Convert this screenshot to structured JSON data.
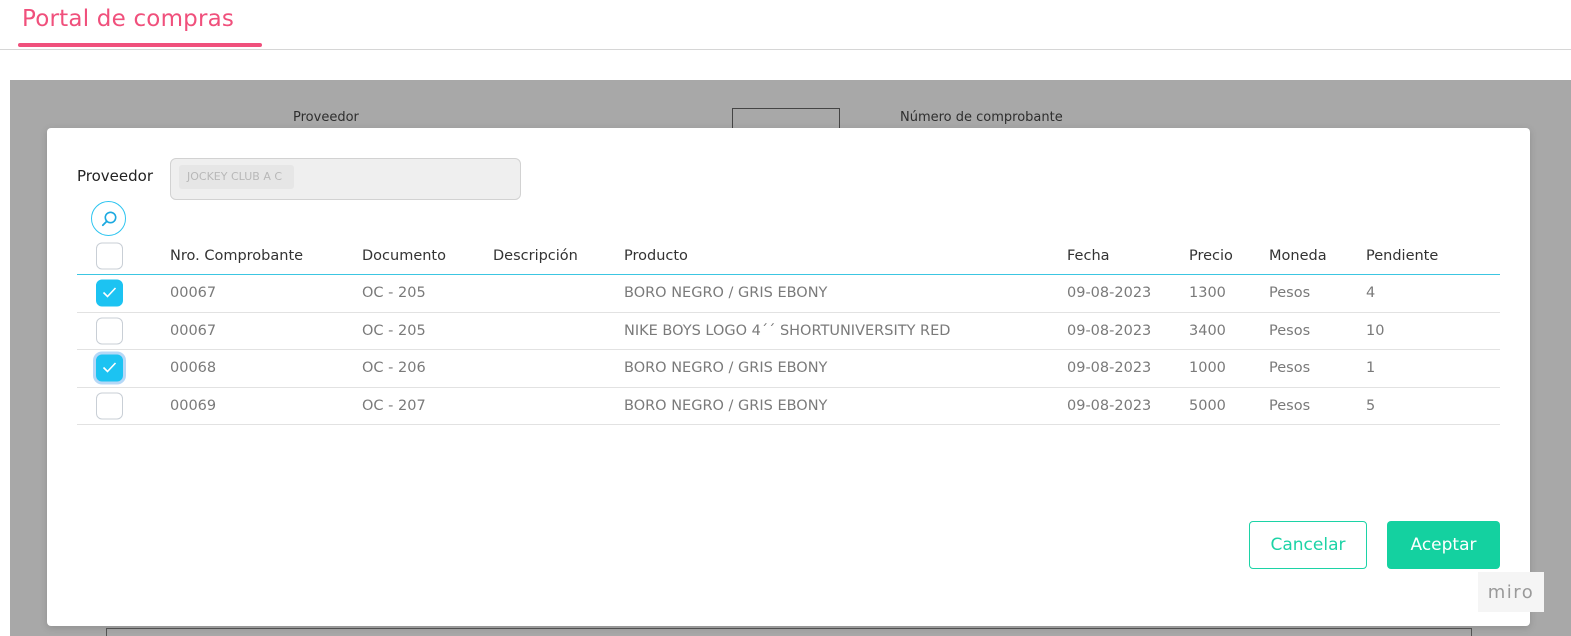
{
  "header": {
    "title": "Portal de compras"
  },
  "background": {
    "proveedor_label": "Proveedor",
    "numero_label": "Número de comprobante"
  },
  "modal": {
    "proveedor_label": "Proveedor",
    "proveedor_value": "JOCKEY CLUB A C",
    "search_icon": "search-icon",
    "table": {
      "headers": {
        "nro": "Nro. Comprobante",
        "documento": "Documento",
        "descripcion": "Descripción",
        "producto": "Producto",
        "fecha": "Fecha",
        "precio": "Precio",
        "moneda": "Moneda",
        "pendiente": "Pendiente"
      },
      "rows": [
        {
          "checked": true,
          "nro": "00067",
          "documento": "OC - 205",
          "descripcion": "",
          "producto": "BORO NEGRO / GRIS EBONY",
          "fecha": "09-08-2023",
          "precio": "1300",
          "moneda": "Pesos",
          "pendiente": "4"
        },
        {
          "checked": false,
          "nro": "00067",
          "documento": "OC - 205",
          "descripcion": "",
          "producto": "NIKE BOYS LOGO 4´´ SHORTUNIVERSITY RED",
          "fecha": "09-08-2023",
          "precio": "3400",
          "moneda": "Pesos",
          "pendiente": "10"
        },
        {
          "checked": true,
          "nro": "00068",
          "documento": "OC - 206",
          "descripcion": "",
          "producto": "BORO NEGRO / GRIS EBONY",
          "fecha": "09-08-2023",
          "precio": "1000",
          "moneda": "Pesos",
          "pendiente": "1"
        },
        {
          "checked": false,
          "nro": "00069",
          "documento": "OC - 207",
          "descripcion": "",
          "producto": "BORO NEGRO / GRIS EBONY",
          "fecha": "09-08-2023",
          "precio": "5000",
          "moneda": "Pesos",
          "pendiente": "5"
        }
      ]
    },
    "buttons": {
      "cancel": "Cancelar",
      "accept": "Aceptar"
    }
  },
  "watermark": "miro",
  "colors": {
    "brand": "#f0507c",
    "accent": "#1cc3f2",
    "success": "#14d1a0"
  }
}
